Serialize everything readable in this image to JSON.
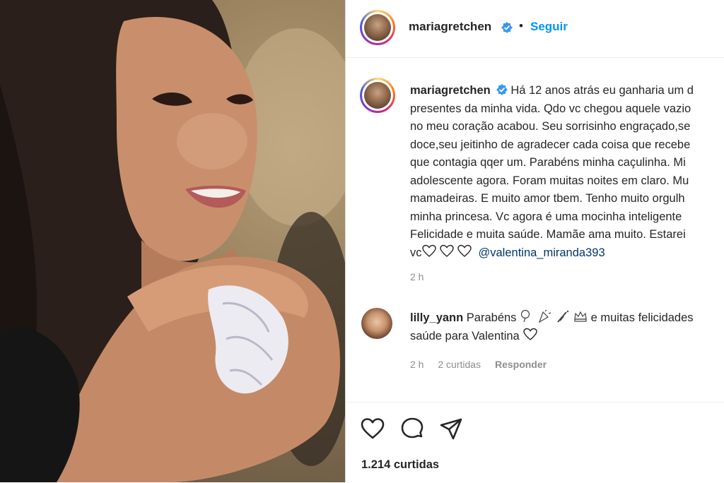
{
  "post": {
    "author": "mariagretchen",
    "follow_label": "Seguir",
    "separator": "•",
    "caption_lines": [
      "Há 12 anos atrás eu ganharia um d",
      "presentes da minha vida. Qdo vc chegou aquele vazio",
      "no meu coração acabou. Seu sorrisinho engraçado,se",
      "doce,seu jeitinho de agradecer cada coisa que recebe",
      "que contagia qqer um. Parabéns minha caçulinha. Mi",
      "adolescente agora. Foram muitas noites em claro. Mu",
      "mamadeiras. E muito amor tbem. Tenho muito orgulh",
      "minha princesa. Vc agora é uma mocinha inteligente",
      "Felicidade e muita saúde. Mamãe ama muito. Estarei"
    ],
    "caption_last_prefix": "vc",
    "mention": "@valentina_miranda393",
    "caption_time": "2 h",
    "likes": "1.214 curtidas"
  },
  "comment": {
    "author": "lilly_yann",
    "text_start": "Parabéns",
    "emojis": [
      "balloon",
      "party-popper",
      "champagne",
      "crown"
    ],
    "text_end": "e muitas felicidades",
    "line2": "saúde para Valentina",
    "time": "2 h",
    "likes": "2 curtidas",
    "reply": "Responder"
  },
  "colors": {
    "link": "#0095f6",
    "mention": "#00376b",
    "text": "#262626",
    "muted": "#8e8e8e"
  }
}
